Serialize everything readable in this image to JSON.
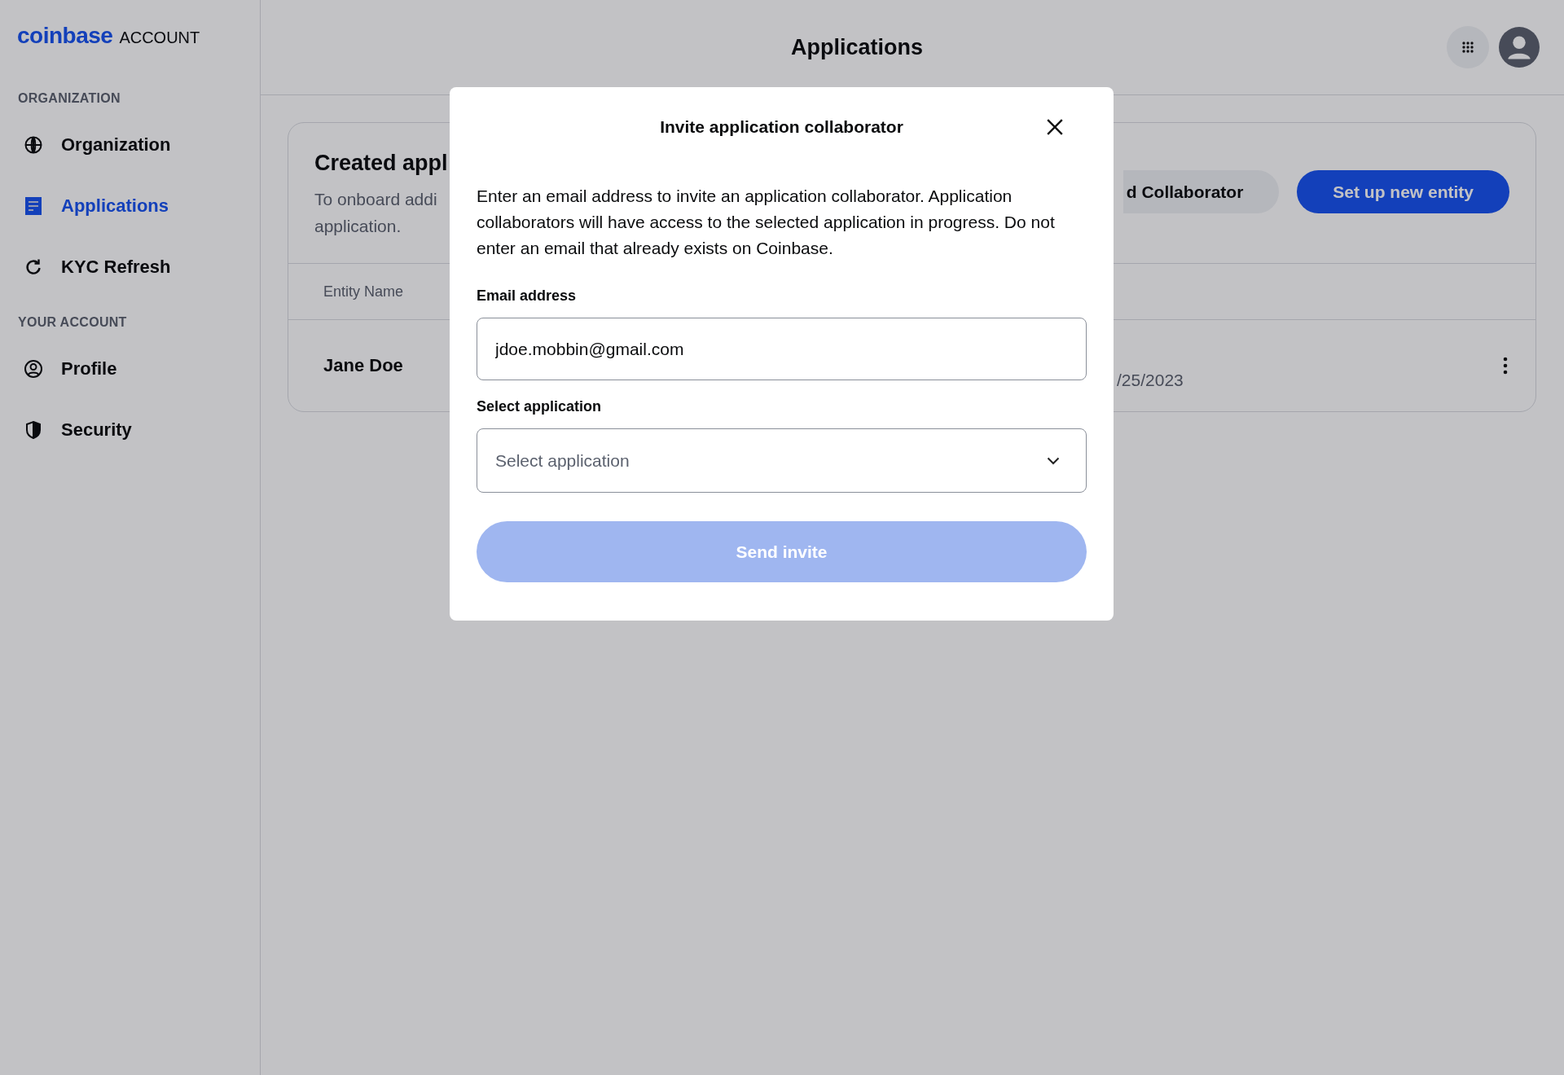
{
  "sidebar": {
    "logo": {
      "brand": "coinbase",
      "product": "ACCOUNT"
    },
    "sections": [
      {
        "heading": "ORGANIZATION",
        "items": [
          {
            "label": "Organization",
            "selected": false
          },
          {
            "label": "Applications",
            "selected": true
          },
          {
            "label": "KYC Refresh",
            "selected": false
          }
        ]
      },
      {
        "heading": "YOUR ACCOUNT",
        "items": [
          {
            "label": "Profile",
            "selected": false
          },
          {
            "label": "Security",
            "selected": false
          }
        ]
      }
    ]
  },
  "header": {
    "title": "Applications"
  },
  "card": {
    "title": "Created appl",
    "description_lines": [
      "To onboard addi",
      "application."
    ],
    "buttons": [
      {
        "label": "d Collaborator",
        "kind": "secondary"
      },
      {
        "label": "Set up new entity",
        "kind": "primary"
      }
    ],
    "table": {
      "columns": [
        "Entity Name"
      ],
      "rows": [
        {
          "cells": [
            "Jane Doe",
            "/25/2023"
          ]
        }
      ]
    }
  },
  "modal": {
    "title": "Invite application collaborator",
    "description": "Enter an email address to invite an application collaborator. Application collaborators will have access to the selected application in progress. Do not enter an email that already exists on Coinbase.",
    "fields": [
      {
        "kind": "text",
        "label": "Email address",
        "value": "jdoe.mobbin@gmail.com"
      },
      {
        "kind": "select",
        "label": "Select application",
        "placeholder": "Select application"
      }
    ],
    "submit": {
      "label": "Send invite",
      "disabled": true
    }
  }
}
